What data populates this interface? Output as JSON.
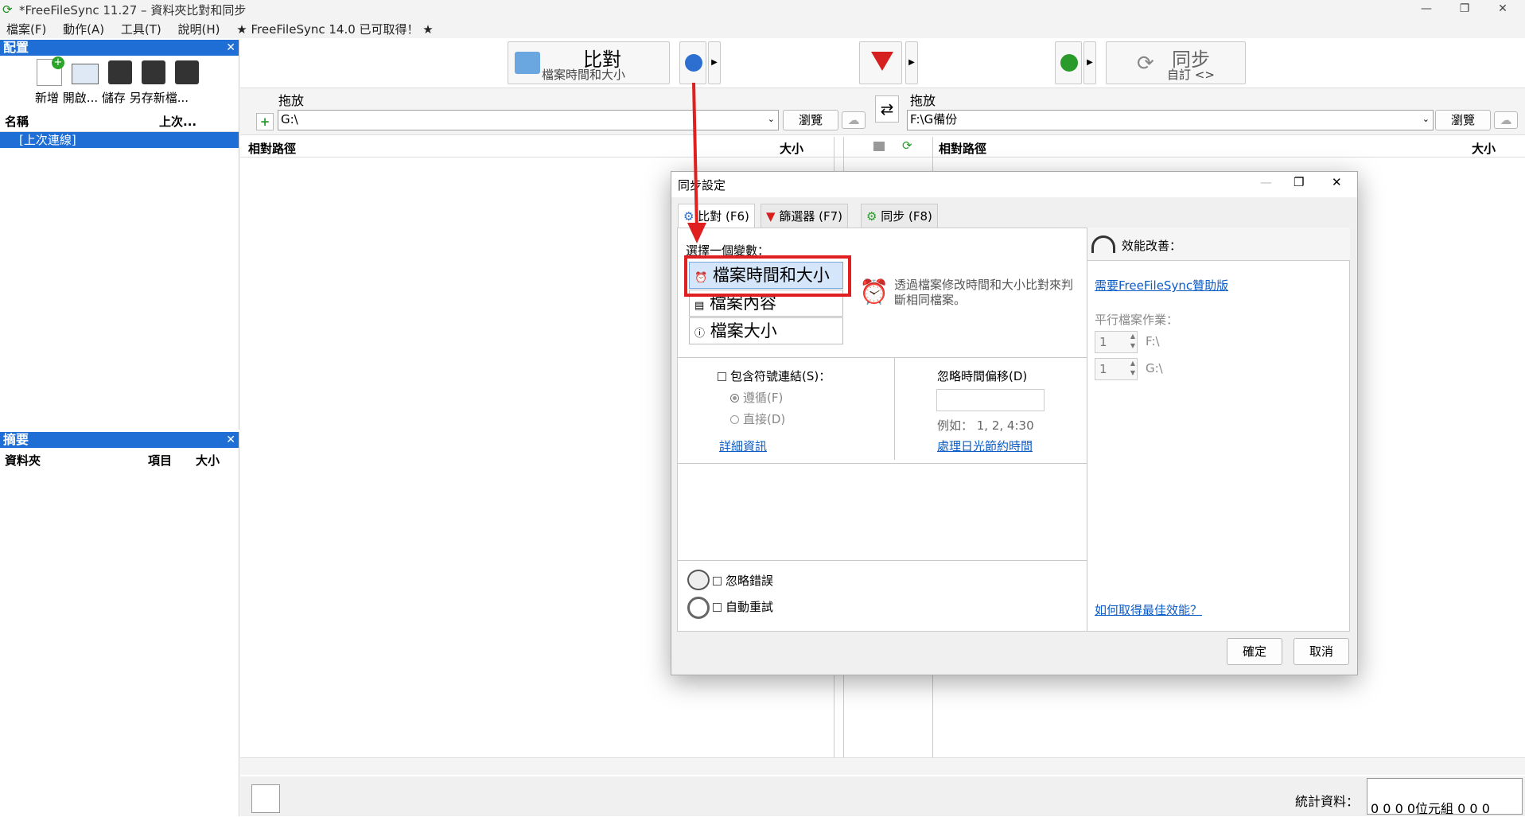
{
  "window": {
    "title": "*FreeFileSync 11.27 – 資料夾比對和同步",
    "min": "—",
    "max": "❐",
    "close": "✕"
  },
  "menu": {
    "items": [
      "檔案(F)",
      "動作(A)",
      "工具(T)",
      "說明(H)",
      "★ FreeFileSync 14.0 已可取得！ ★"
    ]
  },
  "config_pane": {
    "title": "配置",
    "close": "✕",
    "tools": [
      "新增",
      "開啟...",
      "儲存",
      "另存新檔..."
    ],
    "col_name": "名稱",
    "col_last": "上次...",
    "item": "[上次連線]"
  },
  "summary_pane": {
    "title": "摘要",
    "close": "✕",
    "col_folder": "資料夾",
    "col_items": "項目",
    "col_size": "大小"
  },
  "toolbar": {
    "compare_label": "比對",
    "compare_sub": "檔案時間和大小",
    "sync_label": "同步",
    "sync_sub": "自訂 <>"
  },
  "left": {
    "drop_label": "拖放",
    "path": "G:\\",
    "browse": "瀏覽",
    "col_path": "相對路徑",
    "col_size": "大小"
  },
  "right": {
    "drop_label": "拖放",
    "path": "F:\\G備份",
    "browse": "瀏覽",
    "col_path": "相對路徑",
    "col_size": "大小"
  },
  "status": {
    "stats_label": "統計資料：",
    "counts": [
      "0",
      "0",
      "0",
      "0"
    ],
    "bytes_label": "位元組",
    "right_counts": [
      "0",
      "0",
      "0"
    ]
  },
  "dialog": {
    "title": "同步設定",
    "tabs": [
      "比對 (F6)",
      "篩選器 (F7)",
      "同步 (F8)"
    ],
    "choose_variant": "選擇一個變數：",
    "variants": [
      "檔案時間和大小",
      "檔案內容",
      "檔案大小"
    ],
    "variant_desc": "透過檔案修改時間和大小比對來判斷相同檔案。",
    "include_symlinks": "包含符號連結(S)：",
    "follow": "遵循(F)",
    "direct": "直接(D)",
    "more_info": "詳細資訊",
    "ignore_time_shift": "忽略時間偏移(D)",
    "example": "例如： 1, 2, 4:30",
    "dst": "處理日光節約時間",
    "ignore_errors": "忽略錯誤",
    "auto_retry": "自動重試",
    "perf_title": "效能改善：",
    "need_donation": "需要FreeFileSync贊助版",
    "parallel": "平行檔案作業：",
    "par1_value": "1",
    "par1_path": "F:\\",
    "par2_value": "1",
    "par2_path": "G:\\",
    "best_perf": "如何取得最佳效能？",
    "ok": "確定",
    "cancel": "取消"
  },
  "colors": {
    "accent": "#1e6ed6",
    "highlight": "#e02020",
    "selection": "#d5e6fa"
  }
}
